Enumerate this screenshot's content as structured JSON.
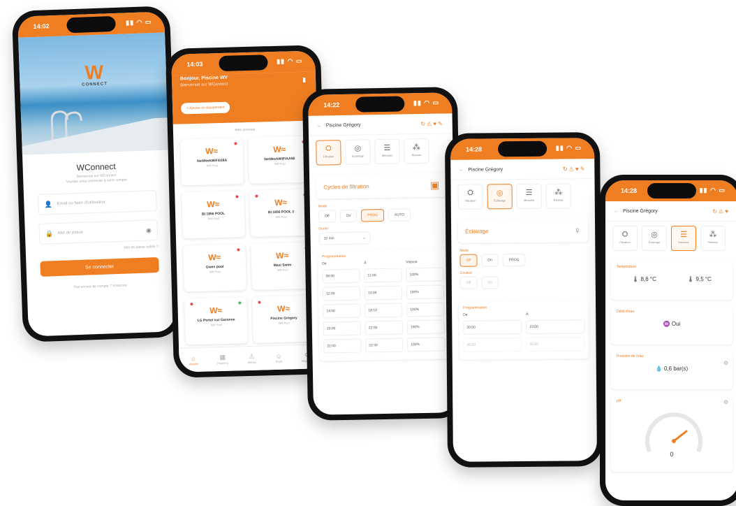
{
  "colors": {
    "accent": "#ef7e22",
    "bg": "#ffffff"
  },
  "login": {
    "time": "14:02",
    "brand": "W",
    "brand_sub": "CONNECT",
    "title": "WConnect",
    "subtitle": "Bienvenue sur WConnect",
    "subtitle2": "Veuillez vous connecter à votre compte",
    "email_placeholder": "Email ou Nom d'utilisateur",
    "password_placeholder": "Mot de passe",
    "forgot": "Mot de passe oublié ?",
    "login_button": "Se connecter",
    "register_text": "Pas encore de compte ? S'inscrire"
  },
  "pools": {
    "time": "14:03",
    "greeting": "Bonjour, Piscine WV",
    "greeting_sub": "Bienvenue sur WConnect",
    "add_button": "+ Ajouter un équipement",
    "section": "Mes piscines",
    "cards": [
      {
        "name": "NetWorkWiFi038A",
        "sub": "Wifi Pool"
      },
      {
        "name": "NetWorkWiFiAA5E",
        "sub": "Wifi Pool"
      },
      {
        "name": "BI 1856 POOL",
        "sub": "Wifi Pool"
      },
      {
        "name": "BI 1856 POOL 2",
        "sub": "Wifi Pool"
      },
      {
        "name": "Gwen pool",
        "sub": "Wifi Pool"
      },
      {
        "name": "Maxi Swim",
        "sub": "Wifi Pool"
      },
      {
        "name": "LG Portet sur Garonne",
        "sub": "Wifi Pool"
      },
      {
        "name": "Piscine Grégory",
        "sub": "Wifi Pool"
      }
    ],
    "nav": [
      "Accueil",
      "Planning",
      "Alertes",
      "Profil",
      "Réglages"
    ]
  },
  "filtration": {
    "time": "14:22",
    "pool_name": "Piscine Grégory",
    "tabs": [
      "Filtration",
      "Éclairage",
      "Mesures",
      "Réseau"
    ],
    "section": "Cycles de filtration",
    "mode_label": "Mode",
    "modes": [
      "Off",
      "On",
      "PROG",
      "AUTO"
    ],
    "duration_label": "Durée",
    "duration_value": "10 min",
    "schedule_title": "Programmation",
    "schedule_cols": [
      "De",
      "À",
      "Vitesse"
    ],
    "schedule": [
      [
        "08:00",
        "11:00",
        "100%"
      ],
      [
        "12:00",
        "13:00",
        "100%"
      ],
      [
        "14:00",
        "18:10",
        "100%"
      ],
      [
        "20:00",
        "22:00",
        "100%"
      ],
      [
        "22:00",
        "22:30",
        "100%"
      ]
    ]
  },
  "lighting": {
    "time": "14:28",
    "pool_name": "Piscine Grégory",
    "tabs": [
      "Filtration",
      "Éclairage",
      "Mesures",
      "Réseau"
    ],
    "section": "Éclairage",
    "mode_label": "Mode",
    "modes": [
      "Off",
      "On",
      "PROG"
    ],
    "color_label": "Couleur",
    "colors": [
      "Off",
      "On"
    ],
    "schedule_title": "Programmation",
    "cols": [
      "De",
      "À"
    ],
    "row1": [
      "20:00",
      "23:00"
    ],
    "row2": [
      "00:00",
      "00:00"
    ]
  },
  "measures": {
    "time": "14:28",
    "pool_name": "Piscine Grégory",
    "tabs": [
      "Filtration",
      "Éclairage",
      "Mesures",
      "Réseau"
    ],
    "temp_title": "Température",
    "temp_in": "8,6 °C",
    "temp_out": "9,5 °C",
    "flow_title": "Débit d'eau",
    "flow_value": "Oui",
    "pressure_title": "Pression de l'eau",
    "pressure_value": "0,6 bar(s)",
    "ph_title": "pH",
    "ph_value": "0"
  }
}
